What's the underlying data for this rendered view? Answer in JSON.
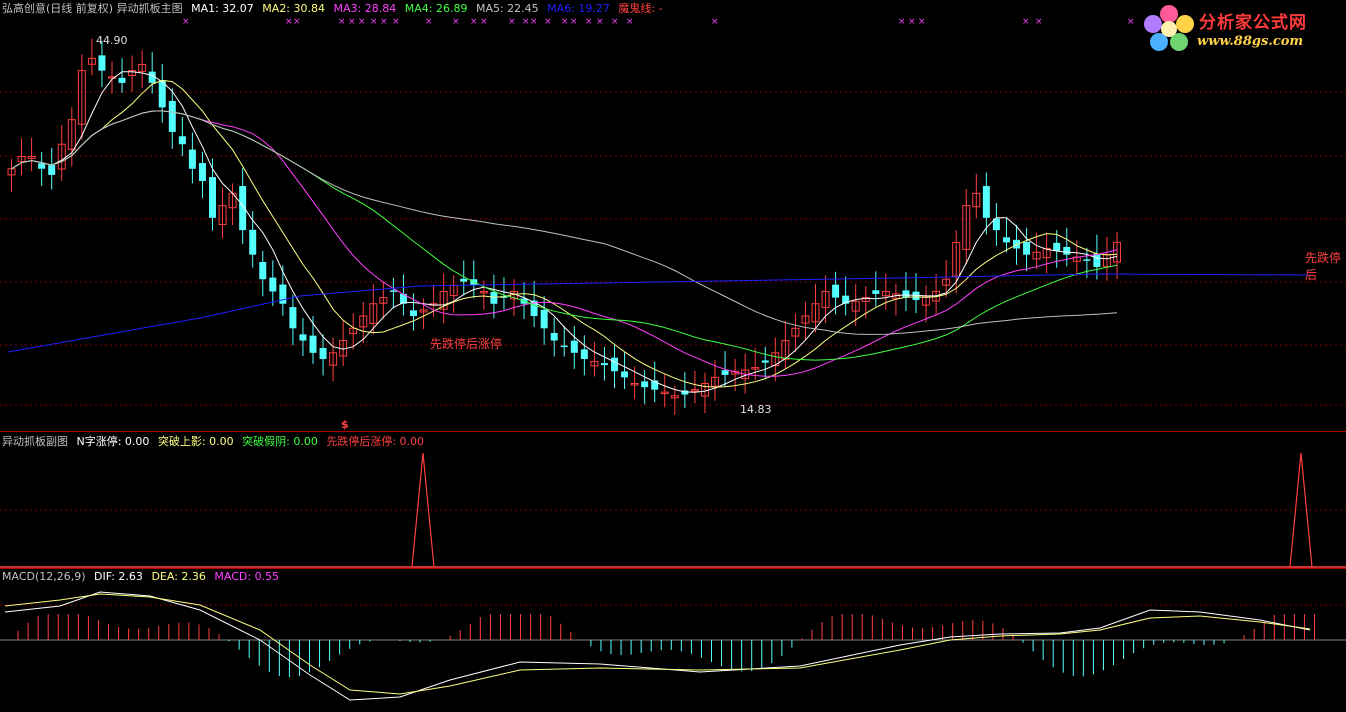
{
  "main_legend": {
    "title": "弘高创意(日线 前复权) 异动抓板主图",
    "ma1": "MA1: 32.07",
    "ma2": "MA2: 30.84",
    "ma3": "MA3: 28.84",
    "ma4": "MA4: 26.89",
    "ma5": "MA5: 22.45",
    "ma6": "MA6: 19.27",
    "devil": "魔鬼线: -"
  },
  "price_labels": {
    "high": "44.90",
    "low": "14.83",
    "signal1": "先跌停后涨停",
    "signal2": "先跌停后"
  },
  "sub_legend": {
    "title": "异动抓板副图",
    "n_limit": "N字涨停: 0.00",
    "break_shadow": "突破上影: 0.00",
    "break_fake": "突破假阴: 0.00",
    "drop_then_limit": "先跌停后涨停: 0.00"
  },
  "macd_legend": {
    "title": "MACD(12,26,9)",
    "dif": "DIF: 2.63",
    "dea": "DEA: 2.36",
    "macd": "MACD: 0.55"
  },
  "logo": {
    "title": "分析家公式网",
    "url": "www.88gs.com"
  },
  "marker_dollar": "$",
  "colors": {
    "up": "#ff4040",
    "down": "#54ffff",
    "ma1": "#ffffff",
    "ma2": "#ffff80",
    "ma3": "#ff40ff",
    "ma4": "#40ff40",
    "ma5": "#c0c0c0",
    "ma6": "#2020ff",
    "grid": "#800000",
    "sep": "#b00000"
  }
}
